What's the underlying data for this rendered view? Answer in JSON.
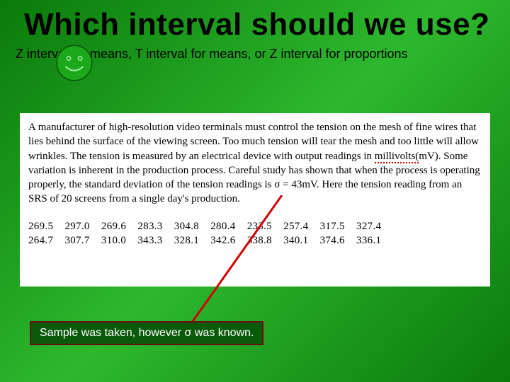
{
  "title": "Which interval should we use?",
  "smiley_name": "smiley-face-icon",
  "subtitle": "Z interval for means, T interval for means, or Z interval for proportions",
  "problem": {
    "before_squiggle": "A manufacturer of high-resolution video terminals must control the tension on the mesh of fine wires that lies behind the surface of the viewing screen. Too much tension will tear the mesh and too little will allow wrinkles. The tension is measured by an electrical device with output readings in ",
    "squiggle_word": "millivolts(",
    "after_squiggle": "mV). Some variation is inherent in the production process. Careful study has shown that when the process is operating properly, the standard deviation of the tension readings is σ = 43mV. Here the tension reading from an SRS of 20 screens from a single day's production."
  },
  "data_rows": [
    "269.5    297.0    269.6    283.3    304.8    280.4    233.5    257.4    317.5    327.4",
    "264.7    307.7    310.0    343.3    328.1    342.6    338.8    340.1    374.6    336.1"
  ],
  "caption": "Sample was taken, however σ was known."
}
